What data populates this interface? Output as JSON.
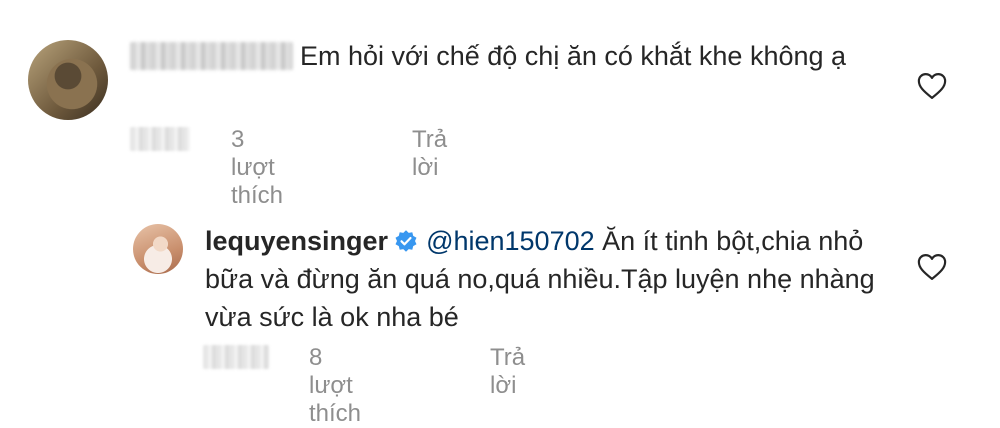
{
  "comments": [
    {
      "username": "",
      "text": "Em hỏi với chế độ chị ăn có khắt khe không ạ",
      "likes": "3 lượt thích",
      "reply": "Trả lời"
    },
    {
      "username": "lequyensinger",
      "mention": "@hien150702",
      "text": " Ăn ít tinh bột,chia nhỏ bữa và đừng ăn quá no,quá nhiều.Tập luyện nhẹ nhàng vừa sức là ok nha bé",
      "likes": "8 lượt thích",
      "reply": "Trả lời"
    }
  ],
  "icons": {
    "like": "heart-outline-icon",
    "verified": "verified-badge-icon"
  },
  "colors": {
    "text": "#262626",
    "meta": "#8e8e8e",
    "mention": "#00376b",
    "verified": "#3897f0"
  }
}
